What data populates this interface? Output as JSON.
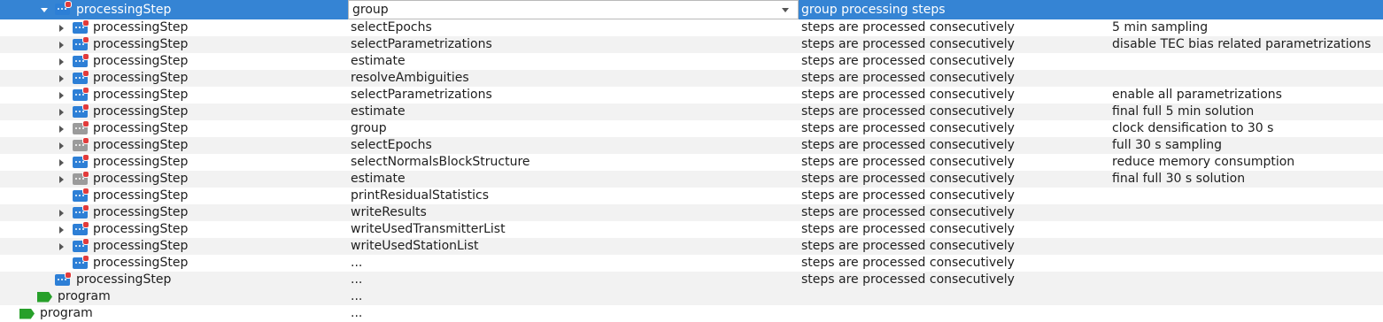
{
  "selected": {
    "name": "processingStep",
    "value": "group",
    "description": "group processing steps"
  },
  "rows": [
    {
      "name": "processingStep",
      "value": "selectEpochs",
      "description": "steps are processed consecutively",
      "comment": "5 min sampling",
      "icon_color": "blue"
    },
    {
      "name": "processingStep",
      "value": "selectParametrizations",
      "description": "steps are processed consecutively",
      "comment": "disable TEC bias related parametrizations",
      "icon_color": "blue"
    },
    {
      "name": "processingStep",
      "value": "estimate",
      "description": "steps are processed consecutively",
      "comment": "",
      "icon_color": "blue"
    },
    {
      "name": "processingStep",
      "value": "resolveAmbiguities",
      "description": "steps are processed consecutively",
      "comment": "",
      "icon_color": "blue"
    },
    {
      "name": "processingStep",
      "value": "selectParametrizations",
      "description": "steps are processed consecutively",
      "comment": "enable all parametrizations",
      "icon_color": "blue"
    },
    {
      "name": "processingStep",
      "value": "estimate",
      "description": "steps are processed consecutively",
      "comment": "final full 5 min solution",
      "icon_color": "blue"
    },
    {
      "name": "processingStep",
      "value": "group",
      "description": "steps are processed consecutively",
      "comment": "clock densification to 30 s",
      "icon_color": "gray"
    },
    {
      "name": "processingStep",
      "value": "selectEpochs",
      "description": "steps are processed consecutively",
      "comment": "full 30 s sampling",
      "icon_color": "gray"
    },
    {
      "name": "processingStep",
      "value": "selectNormalsBlockStructure",
      "description": "steps are processed consecutively",
      "comment": "reduce memory consumption",
      "icon_color": "blue"
    },
    {
      "name": "processingStep",
      "value": "estimate",
      "description": "steps are processed consecutively",
      "comment": "final full 30 s solution",
      "icon_color": "gray"
    },
    {
      "name": "processingStep",
      "value": "printResidualStatistics",
      "description": "steps are processed consecutively",
      "comment": "",
      "icon_color": "blue"
    },
    {
      "name": "processingStep",
      "value": "writeResults",
      "description": "steps are processed consecutively",
      "comment": "",
      "icon_color": "blue"
    },
    {
      "name": "processingStep",
      "value": "writeUsedTransmitterList",
      "description": "steps are processed consecutively",
      "comment": "",
      "icon_color": "blue"
    },
    {
      "name": "processingStep",
      "value": "writeUsedStationList",
      "description": "steps are processed consecutively",
      "comment": "",
      "icon_color": "blue"
    },
    {
      "name": "processingStep",
      "value": "...",
      "description": "steps are processed consecutively",
      "comment": "",
      "icon_color": "blue"
    }
  ],
  "outer_step": {
    "name": "processingStep",
    "value": "...",
    "description": "steps are processed consecutively"
  },
  "programs": [
    {
      "name": "program",
      "value": "..."
    },
    {
      "name": "program",
      "value": "..."
    }
  ],
  "colors": {
    "selection": "#3584d4",
    "step_icon": "#2d7fd6",
    "step_icon_disabled": "#9b9b9b",
    "program_icon": "#27a02a",
    "badge": "#e23b3b"
  }
}
